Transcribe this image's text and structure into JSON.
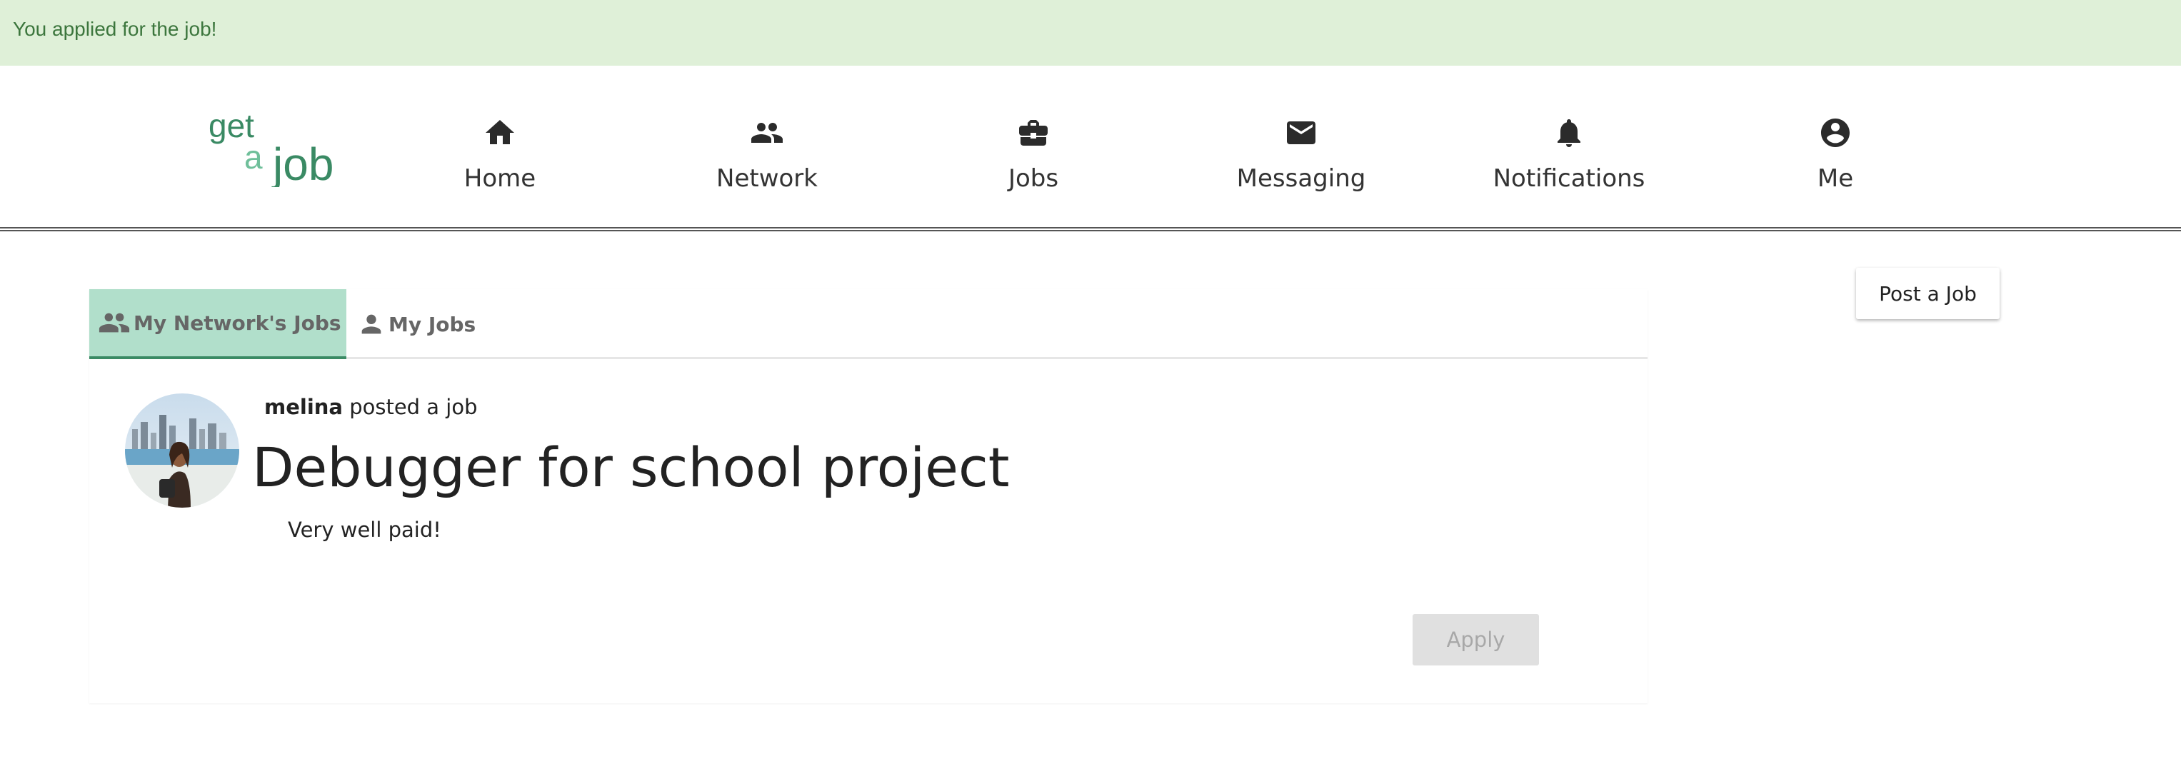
{
  "alert": {
    "message": "You applied for the job!",
    "color": "#3c763d",
    "background": "#dff0d8"
  },
  "brand": {
    "logo_line1": "get",
    "logo_line2a": "a",
    "logo_line2b": "job",
    "accent": "#3a8a64",
    "accent_light": "#6fbf9a"
  },
  "nav": {
    "items": [
      {
        "label": "Home",
        "icon": "home-icon"
      },
      {
        "label": "Network",
        "icon": "people-icon"
      },
      {
        "label": "Jobs",
        "icon": "briefcase-icon"
      },
      {
        "label": "Messaging",
        "icon": "mail-icon"
      },
      {
        "label": "Notifications",
        "icon": "bell-icon"
      },
      {
        "label": "Me",
        "icon": "account-circle-icon"
      }
    ]
  },
  "actions": {
    "post_job_label": "Post a Job"
  },
  "tabs": [
    {
      "label": "My Network's Jobs",
      "icon": "people-icon",
      "active": true
    },
    {
      "label": "My Jobs",
      "icon": "person-icon",
      "active": false
    }
  ],
  "job": {
    "poster_name": "melina",
    "poster_suffix": "posted a job",
    "title": "Debugger for school project",
    "description": "Very well paid!",
    "apply_label": "Apply",
    "apply_disabled": true
  }
}
